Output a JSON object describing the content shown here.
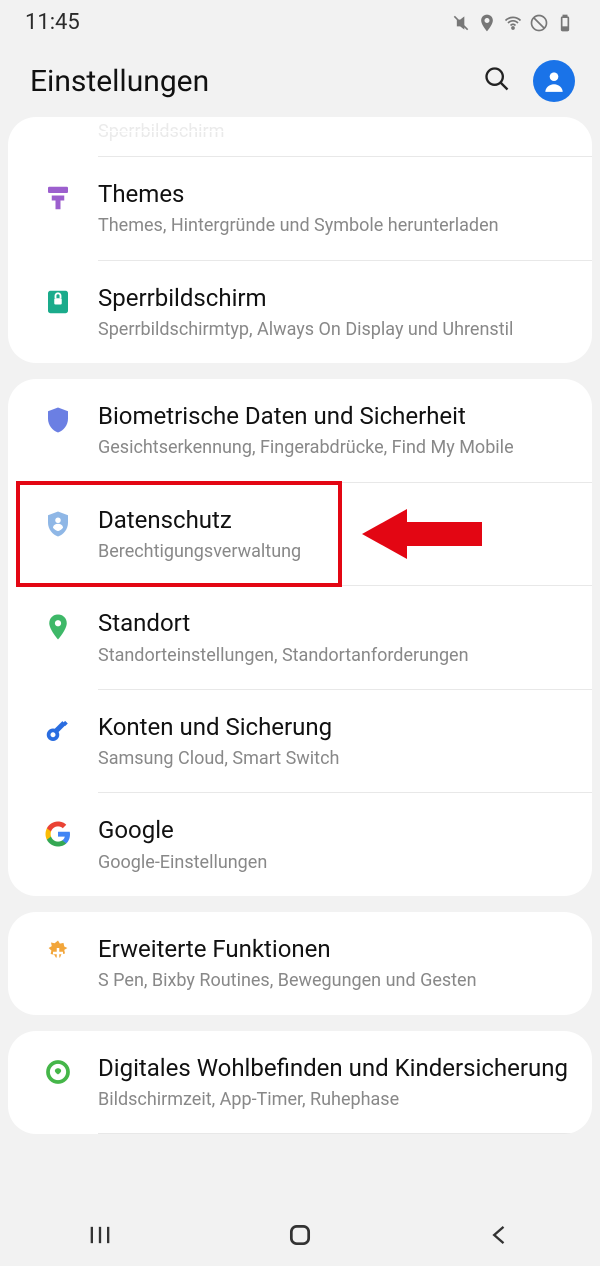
{
  "status": {
    "time": "11:45"
  },
  "header": {
    "title": "Einstellungen"
  },
  "groups": [
    {
      "cut_label": "Sperrbildschirm",
      "items": [
        {
          "icon": "themes-icon",
          "color": "#9c5fce",
          "title": "Themes",
          "sub": "Themes, Hintergründe und Symbole herunterladen"
        },
        {
          "icon": "lock-icon",
          "color": "#1aab8b",
          "title": "Sperrbildschirm",
          "sub": "Sperrbildschirmtyp, Always On Display und Uhrenstil"
        }
      ]
    },
    {
      "items": [
        {
          "icon": "shield-icon",
          "color": "#6b7fe3",
          "title": "Biometrische Daten und Sicherheit",
          "sub": "Gesichtserkennung, Fingerabdrücke, Find My Mobile"
        },
        {
          "icon": "shield-person-icon",
          "color": "#8fb7e6",
          "title": "Datenschutz",
          "sub": "Berechtigungsverwaltung",
          "highlight": true
        },
        {
          "icon": "location-icon",
          "color": "#3eb868",
          "title": "Standort",
          "sub": "Standorteinstellungen, Standortanforderungen"
        },
        {
          "icon": "key-icon",
          "color": "#2a6de0",
          "title": "Konten und Sicherung",
          "sub": "Samsung Cloud, Smart Switch"
        },
        {
          "icon": "google-icon",
          "color": "#4285f4",
          "title": "Google",
          "sub": "Google-Einstellungen"
        }
      ]
    },
    {
      "items": [
        {
          "icon": "gear-plus-icon",
          "color": "#f2a63b",
          "title": "Erweiterte Funktionen",
          "sub": "S Pen, Bixby Routines, Bewegungen und Gesten"
        }
      ]
    },
    {
      "items": [
        {
          "icon": "wellbeing-icon",
          "color": "#45b649",
          "title": "Digitales Wohlbefinden und Kindersicherung",
          "sub": "Bildschirmzeit, App-Timer, Ruhephase"
        }
      ]
    }
  ]
}
